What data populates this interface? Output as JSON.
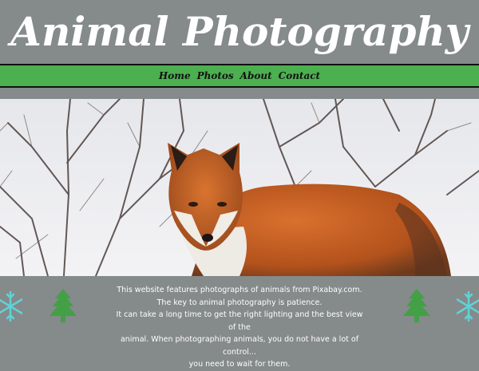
{
  "header": {
    "title": "Animal Photography"
  },
  "nav": {
    "items": [
      "Home",
      "Photos",
      "About",
      "Contact"
    ]
  },
  "hero": {
    "image_alt": "Red fox standing in snow among bare branches"
  },
  "caption": {
    "lines": [
      "This website features photographs of animals from Pixabay.com.",
      "The key to animal photography is patience.",
      "It can take a long time to get the right lighting and the best view of the",
      "animal. When photographing animals, you do not have a lot of control...",
      "you need to wait for them."
    ]
  },
  "decorations": {
    "snowflake_color": "#5fd3d8",
    "tree_color": "#43a047"
  },
  "colors": {
    "background": "#858a8a",
    "nav_bar": "#4caf50",
    "title_text": "#ffffff"
  }
}
